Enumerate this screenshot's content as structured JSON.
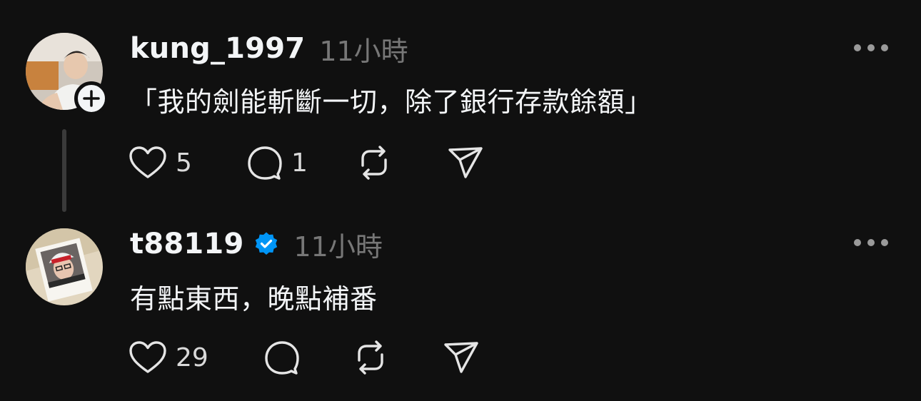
{
  "posts": [
    {
      "username": "kung_1997",
      "timestamp": "11小時",
      "text": "「我的劍能斬斷一切，除了銀行存款餘額」",
      "likes": "5",
      "replies": "1",
      "verified": false,
      "show_follow": true
    },
    {
      "username": "t88119",
      "timestamp": "11小時",
      "text": "有點東西，晚點補番",
      "likes": "29",
      "replies": "",
      "verified": true,
      "show_follow": false
    }
  ],
  "colors": {
    "background": "#101010",
    "text": "#f3f5f7",
    "muted": "#777777",
    "verified_blue": "#0095f6",
    "thread_line": "#3a3a3a"
  },
  "icons": [
    "heart-icon",
    "comment-icon",
    "repost-icon",
    "share-icon",
    "more-icon",
    "plus-icon",
    "verified-badge-icon"
  ]
}
